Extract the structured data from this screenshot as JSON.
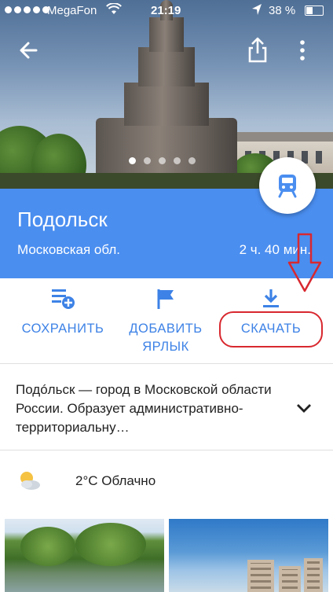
{
  "status_bar": {
    "carrier": "MegaFon",
    "time": "21:19",
    "battery": "38 %"
  },
  "hero": {
    "carousel_pages": 5,
    "carousel_active": 1
  },
  "place": {
    "title": "Подольск",
    "region": "Московская обл.",
    "duration": "2 ч. 40 мин."
  },
  "actions": {
    "save": "СОХРАНИТЬ",
    "add_label_line1": "ДОБАВИТЬ",
    "add_label_line2": "ЯРЛЫК",
    "download": "СКАЧАТЬ"
  },
  "description": {
    "text": "Подóльск — город в Московской области России. Образует административно-территориальну…"
  },
  "weather": {
    "text": "2°C Облачно"
  },
  "colors": {
    "accent": "#4a8ef0",
    "action_text": "#3d82e6",
    "annotation_red": "#d8282f"
  }
}
